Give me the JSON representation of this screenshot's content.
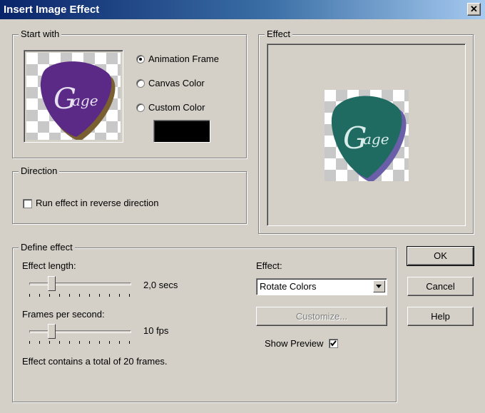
{
  "window": {
    "title": "Insert Image Effect",
    "close_glyph": "✕"
  },
  "start_with": {
    "label": "Start with",
    "options": [
      {
        "label": "Animation Frame",
        "checked": true
      },
      {
        "label": "Canvas Color",
        "checked": false
      },
      {
        "label": "Custom Color",
        "checked": false
      }
    ],
    "custom_color": "#000000",
    "thumbnail_text": "Gage",
    "thumbnail_color": "#5a2a86"
  },
  "effect_preview": {
    "label": "Effect",
    "preview_text": "Gage",
    "preview_color": "#1f6b62"
  },
  "direction": {
    "label": "Direction",
    "reverse_label": "Run effect in reverse direction",
    "reverse_checked": false
  },
  "define_effect": {
    "label": "Define effect",
    "effect_length_label": "Effect length:",
    "effect_length_value": "2,0 secs",
    "fps_label": "Frames per second:",
    "fps_value": "10 fps",
    "summary": "Effect contains a total of 20 frames.",
    "effect_label": "Effect:",
    "effect_selected": "Rotate Colors",
    "customize_label": "Customize...",
    "show_preview_label": "Show Preview",
    "show_preview_checked": true
  },
  "buttons": {
    "ok": "OK",
    "cancel": "Cancel",
    "help": "Help"
  }
}
